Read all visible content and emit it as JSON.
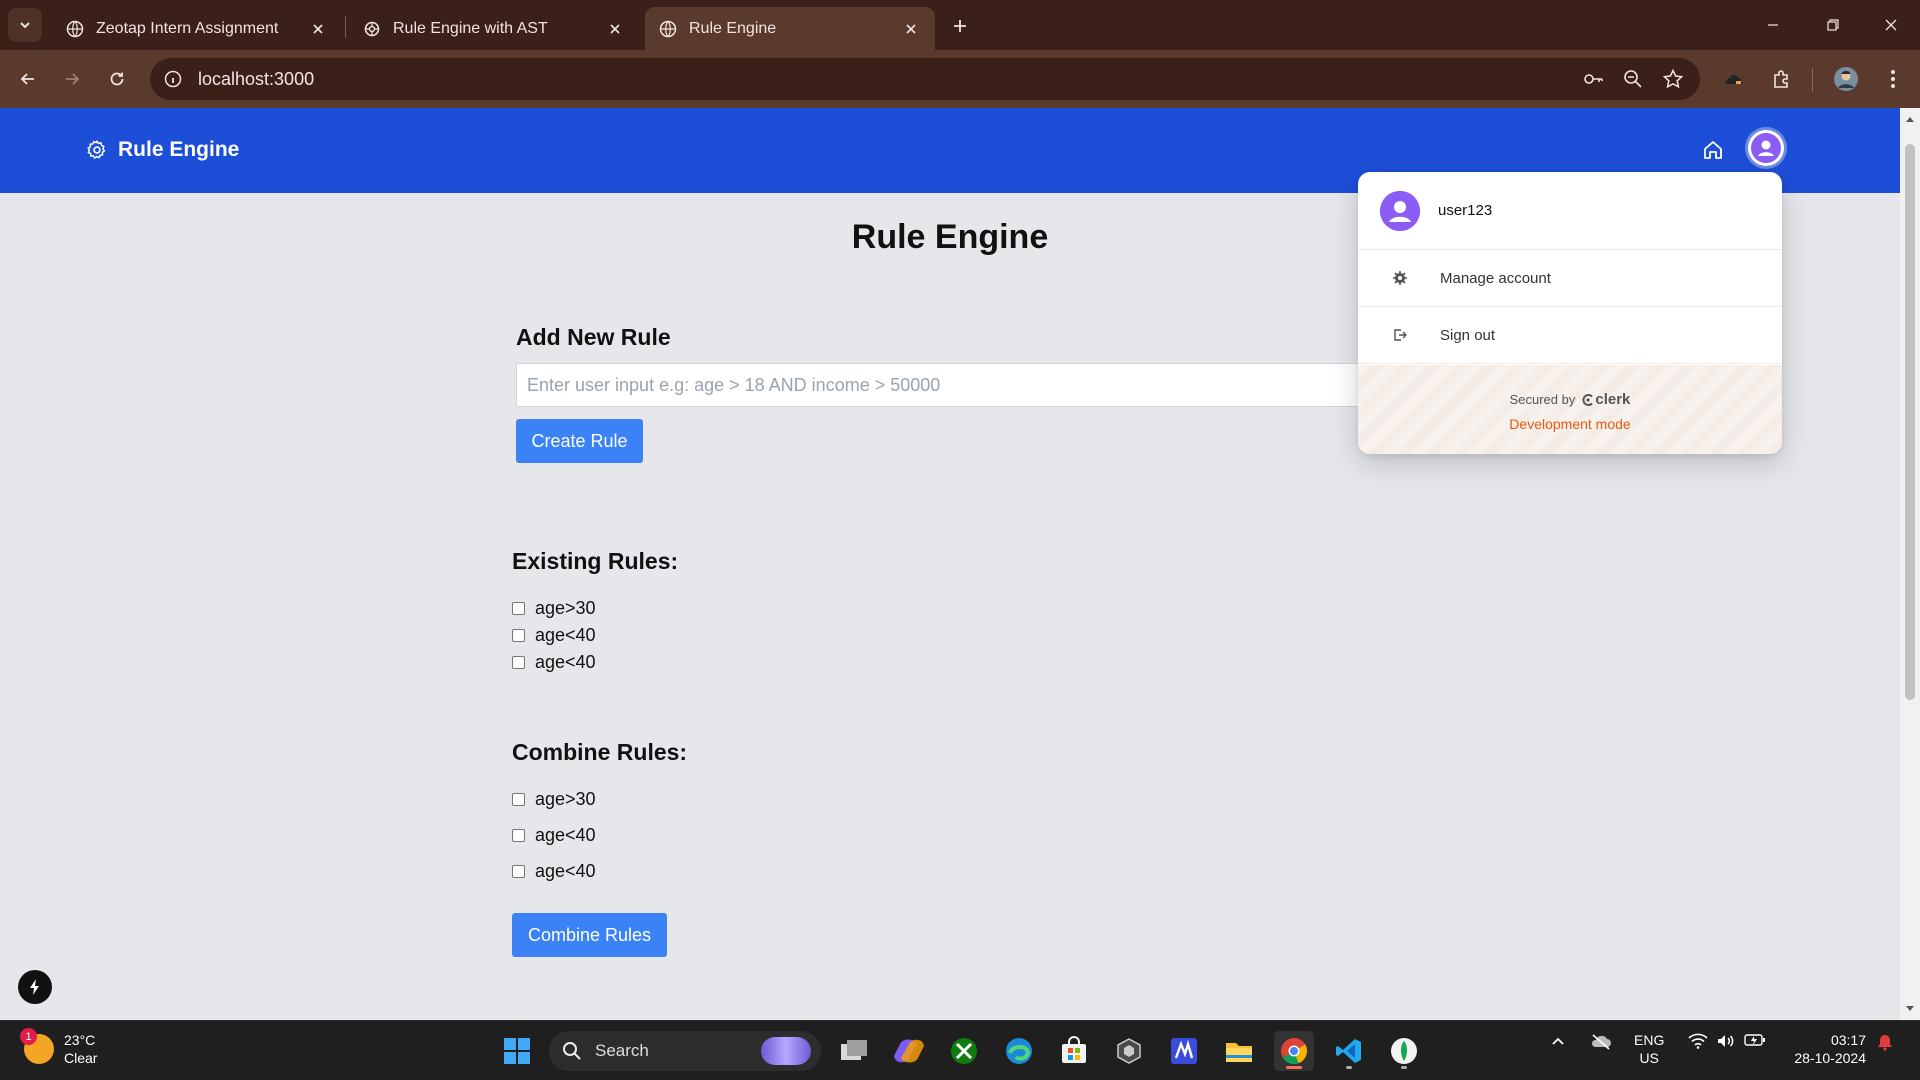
{
  "browser": {
    "tabs": [
      {
        "title": "Zeotap Intern Assignment",
        "active": false
      },
      {
        "title": "Rule Engine with AST",
        "active": false
      },
      {
        "title": "Rule Engine",
        "active": true
      }
    ],
    "url": "localhost:3000"
  },
  "app": {
    "brand": "Rule Engine",
    "page_title": "Rule Engine",
    "add_rule": {
      "title": "Add New Rule",
      "placeholder": "Enter user input e.g: age > 18 AND income > 50000",
      "value": "",
      "button": "Create Rule"
    },
    "existing_rules": {
      "title": "Existing Rules:",
      "items": [
        "age>30",
        "age<40",
        "age<40"
      ]
    },
    "combine_rules": {
      "title": "Combine Rules:",
      "items": [
        "age>30",
        "age<40",
        "age<40"
      ],
      "button": "Combine Rules"
    },
    "colors": {
      "header": "#1d4ed8",
      "button": "#3b82f6",
      "page_bg": "#e5e7eb",
      "dev_mode": "#ea580c"
    }
  },
  "user_menu": {
    "username": "user123",
    "manage_account": "Manage account",
    "sign_out": "Sign out",
    "secured_by": "Secured by",
    "provider": "clerk",
    "dev_mode": "Development mode"
  },
  "taskbar": {
    "weather": {
      "temp": "23°C",
      "condition": "Clear",
      "badge": "1"
    },
    "search_label": "Search",
    "lang_line1": "ENG",
    "lang_line2": "US",
    "time": "03:17",
    "date": "28-10-2024",
    "apps": [
      "windows-start",
      "search",
      "task-view",
      "copilot",
      "xbox",
      "edge",
      "store",
      "unity",
      "app",
      "file-explorer",
      "chrome",
      "vscode",
      "mongodb-compass"
    ]
  }
}
